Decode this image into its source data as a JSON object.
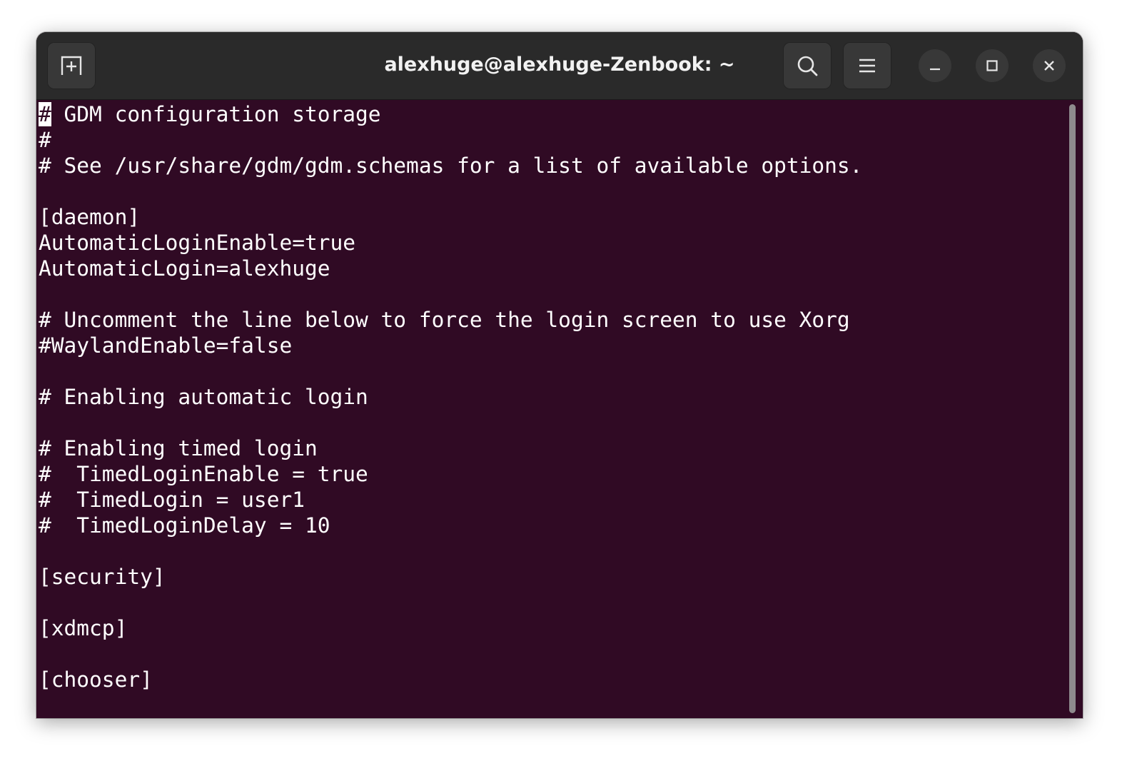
{
  "window": {
    "title": "alexhuge@alexhuge-Zenbook: ~"
  },
  "header_buttons": {
    "new_tab_icon": "new-tab-icon",
    "search_icon": "search-icon",
    "menu_icon": "hamburger-menu-icon",
    "minimize_icon": "minimize-icon",
    "maximize_icon": "maximize-icon",
    "close_icon": "close-icon"
  },
  "terminal": {
    "cursor_char": "#",
    "lines": [
      " GDM configuration storage",
      "#",
      "# See /usr/share/gdm/gdm.schemas for a list of available options.",
      "",
      "[daemon]",
      "AutomaticLoginEnable=true",
      "AutomaticLogin=alexhuge",
      "",
      "# Uncomment the line below to force the login screen to use Xorg",
      "#WaylandEnable=false",
      "",
      "# Enabling automatic login",
      "",
      "# Enabling timed login",
      "#  TimedLoginEnable = true",
      "#  TimedLogin = user1",
      "#  TimedLoginDelay = 10",
      "",
      "[security]",
      "",
      "[xdmcp]",
      "",
      "[chooser]"
    ]
  },
  "colors": {
    "terminal_bg": "#300a24",
    "headerbar_bg": "#2a2a2a",
    "text": "#ffffff"
  }
}
